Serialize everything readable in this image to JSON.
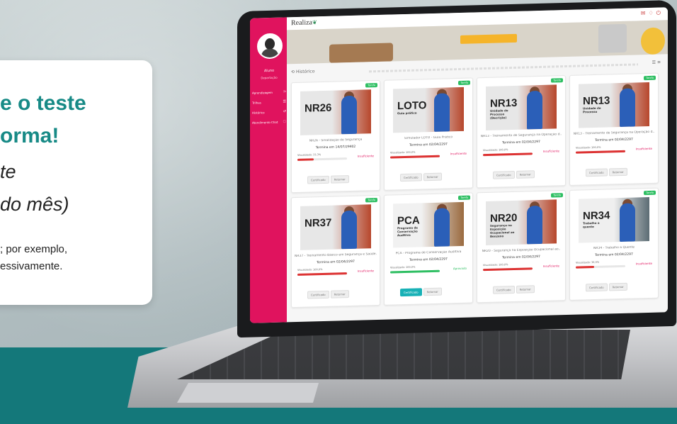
{
  "promo": {
    "line1": "e o teste",
    "line2": "orma!",
    "line3": "te",
    "line4": "do mês)",
    "line5": "; por exemplo,",
    "line6": "essivamente."
  },
  "app": {
    "logo": "Realiza",
    "sidebar": {
      "user_name": "Aluno",
      "user_role": "Departação",
      "items": [
        {
          "label": "Aprendizagem",
          "icon": "book-icon"
        },
        {
          "label": "Trilhas",
          "icon": "list-icon"
        },
        {
          "label": "Histórico",
          "icon": "history-icon"
        },
        {
          "label": "Atendimento Chat",
          "icon": "chat-icon"
        }
      ]
    },
    "section_title": "Histórico",
    "cards": [
      {
        "code": "NR26",
        "subtitle": "",
        "title": "NR26 - Sinalização de Segurança",
        "date": "Termina em 14/07/29402",
        "visualizado": "Visualizado: 33,3%",
        "progress": 0.33,
        "status": "Insuficiente",
        "status_type": "bad",
        "badge": "Tarefa"
      },
      {
        "code": "LOTO",
        "subtitle": "Guia prático",
        "title": "Simulador LOTO - Guia Prático",
        "date": "Termina em 02/04/2297",
        "visualizado": "Visualizado: 100,0%",
        "progress": 1.0,
        "status": "Insuficiente",
        "status_type": "bad",
        "badge": "Tarefa"
      },
      {
        "code": "NR13",
        "subtitle": "Unidade de Processo (Decrição)",
        "title": "NR13 - Treinamento de Segurança na Operação d..",
        "date": "Termina em 02/04/2297",
        "visualizado": "Visualizado: 100,0%",
        "progress": 1.0,
        "status": "Insuficiente",
        "status_type": "bad",
        "badge": "Tarefa"
      },
      {
        "code": "NR13",
        "subtitle": "Unidade de Processo",
        "title": "NR13 - Treinamento de Segurança na Operação d..",
        "date": "Termina em 02/04/2297",
        "visualizado": "Visualizado: 100,0%",
        "progress": 1.0,
        "status": "Insuficiente",
        "status_type": "bad",
        "badge": "Tarefa"
      },
      {
        "code": "NR37",
        "subtitle": "",
        "title": "NR37 - Treinamento Básico em Segurança e Saúde..",
        "date": "Termina em 02/04/2297",
        "visualizado": "Visualizado: 100,0%",
        "progress": 1.0,
        "status": "Insuficiente",
        "status_type": "bad",
        "badge": "Tarefa"
      },
      {
        "code": "PCA",
        "subtitle": "Programa de Conservação Auditiva",
        "title": "PCA - Programa de Conservação Auditiva",
        "date": "Termina em 02/04/2297",
        "visualizado": "Visualizado: 100,0%",
        "progress": 1.0,
        "status": "Aprovado",
        "status_type": "ok",
        "badge": "Tarefa"
      },
      {
        "code": "NR20",
        "subtitle": "Segurança na Exposição Ocupacional ao Benzeno",
        "title": "NR20 - Segurança na Exposição Ocupacional ao..",
        "date": "Termina em 02/04/2297",
        "visualizado": "Visualizado: 100,0%",
        "progress": 1.0,
        "status": "Insuficiente",
        "status_type": "bad",
        "badge": "Tarefa"
      },
      {
        "code": "NR34",
        "subtitle": "Trabalho a quente",
        "title": "NR34 - Trabalho a Quente",
        "date": "Termina em 02/04/2297",
        "visualizado": "Visualizado: 36,9%",
        "progress": 0.37,
        "status": "Insuficiente",
        "status_type": "bad",
        "badge": "Tarefa"
      }
    ],
    "buttons": {
      "certificate": "Certificado",
      "retry": "Retomar"
    }
  },
  "colors": {
    "sidebar": "#e0135e",
    "teal_band": "#14787a",
    "headline": "#178a86",
    "badge": "#2fbf63"
  }
}
